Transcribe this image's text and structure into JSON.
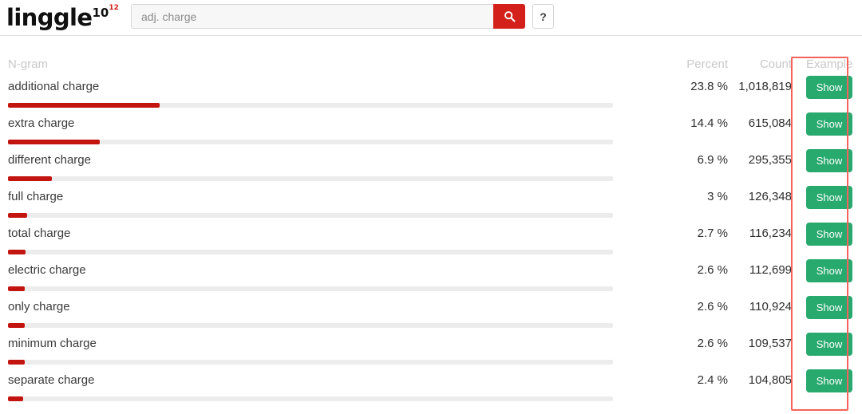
{
  "brand": {
    "word": "linggle",
    "version": "10",
    "superscript": "12"
  },
  "search": {
    "value": "adj. charge",
    "placeholder": "adj. charge",
    "search_icon": "search-icon",
    "help_label": "?"
  },
  "table": {
    "headers": {
      "ngram": "N-gram",
      "percent": "Percent",
      "count": "Count",
      "example": "Example"
    },
    "action_label": "Show",
    "rows": [
      {
        "ngram": "additional charge",
        "percent": "23.8 %",
        "percent_value": 23.8,
        "count": "1,018,819"
      },
      {
        "ngram": "extra charge",
        "percent": "14.4 %",
        "percent_value": 14.4,
        "count": "615,084"
      },
      {
        "ngram": "different charge",
        "percent": "6.9 %",
        "percent_value": 6.9,
        "count": "295,355"
      },
      {
        "ngram": "full charge",
        "percent": "3 %",
        "percent_value": 3.0,
        "count": "126,348"
      },
      {
        "ngram": "total charge",
        "percent": "2.7 %",
        "percent_value": 2.7,
        "count": "116,234"
      },
      {
        "ngram": "electric charge",
        "percent": "2.6 %",
        "percent_value": 2.6,
        "count": "112,699"
      },
      {
        "ngram": "only charge",
        "percent": "2.6 %",
        "percent_value": 2.6,
        "count": "110,924"
      },
      {
        "ngram": "minimum charge",
        "percent": "2.6 %",
        "percent_value": 2.6,
        "count": "109,537"
      },
      {
        "ngram": "separate charge",
        "percent": "2.4 %",
        "percent_value": 2.4,
        "count": "104,805"
      }
    ]
  },
  "colors": {
    "brand_red": "#d3201a",
    "bar_red": "#c3150f",
    "bar_track": "#ececed",
    "show_green": "#28a96d",
    "annotation_red": "#f4635c",
    "header_gray": "#c9c9c9"
  },
  "annotation": {
    "target": "example-column"
  }
}
